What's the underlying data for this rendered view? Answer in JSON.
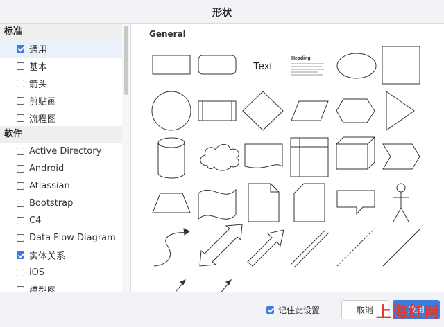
{
  "dialog": {
    "title": "形状"
  },
  "sidebar": {
    "sections": [
      {
        "header": "标准",
        "items": [
          {
            "label": "通用",
            "checked": true,
            "active": true
          },
          {
            "label": "基本",
            "checked": false
          },
          {
            "label": "箭头",
            "checked": false
          },
          {
            "label": "剪贴画",
            "checked": false
          },
          {
            "label": "流程图",
            "checked": false
          }
        ]
      },
      {
        "header": "软件",
        "items": [
          {
            "label": "Active Directory",
            "checked": false
          },
          {
            "label": "Android",
            "checked": false
          },
          {
            "label": "Atlassian",
            "checked": false
          },
          {
            "label": "Bootstrap",
            "checked": false
          },
          {
            "label": "C4",
            "checked": false
          },
          {
            "label": "Data Flow Diagram",
            "checked": false
          },
          {
            "label": "实体关系",
            "checked": true
          },
          {
            "label": "iOS",
            "checked": false
          },
          {
            "label": "模型图",
            "checked": false
          }
        ]
      }
    ]
  },
  "main": {
    "group_title": "General",
    "shapes": {
      "text_label": "Text",
      "heading_label": "Heading"
    }
  },
  "footer": {
    "remember_label": "记住此设置",
    "remember_checked": true,
    "cancel_label": "取消",
    "ok_label": "应用"
  },
  "watermark": "上海红网",
  "colors": {
    "accent": "#3c7be0",
    "watermark": "#e03a2b"
  }
}
